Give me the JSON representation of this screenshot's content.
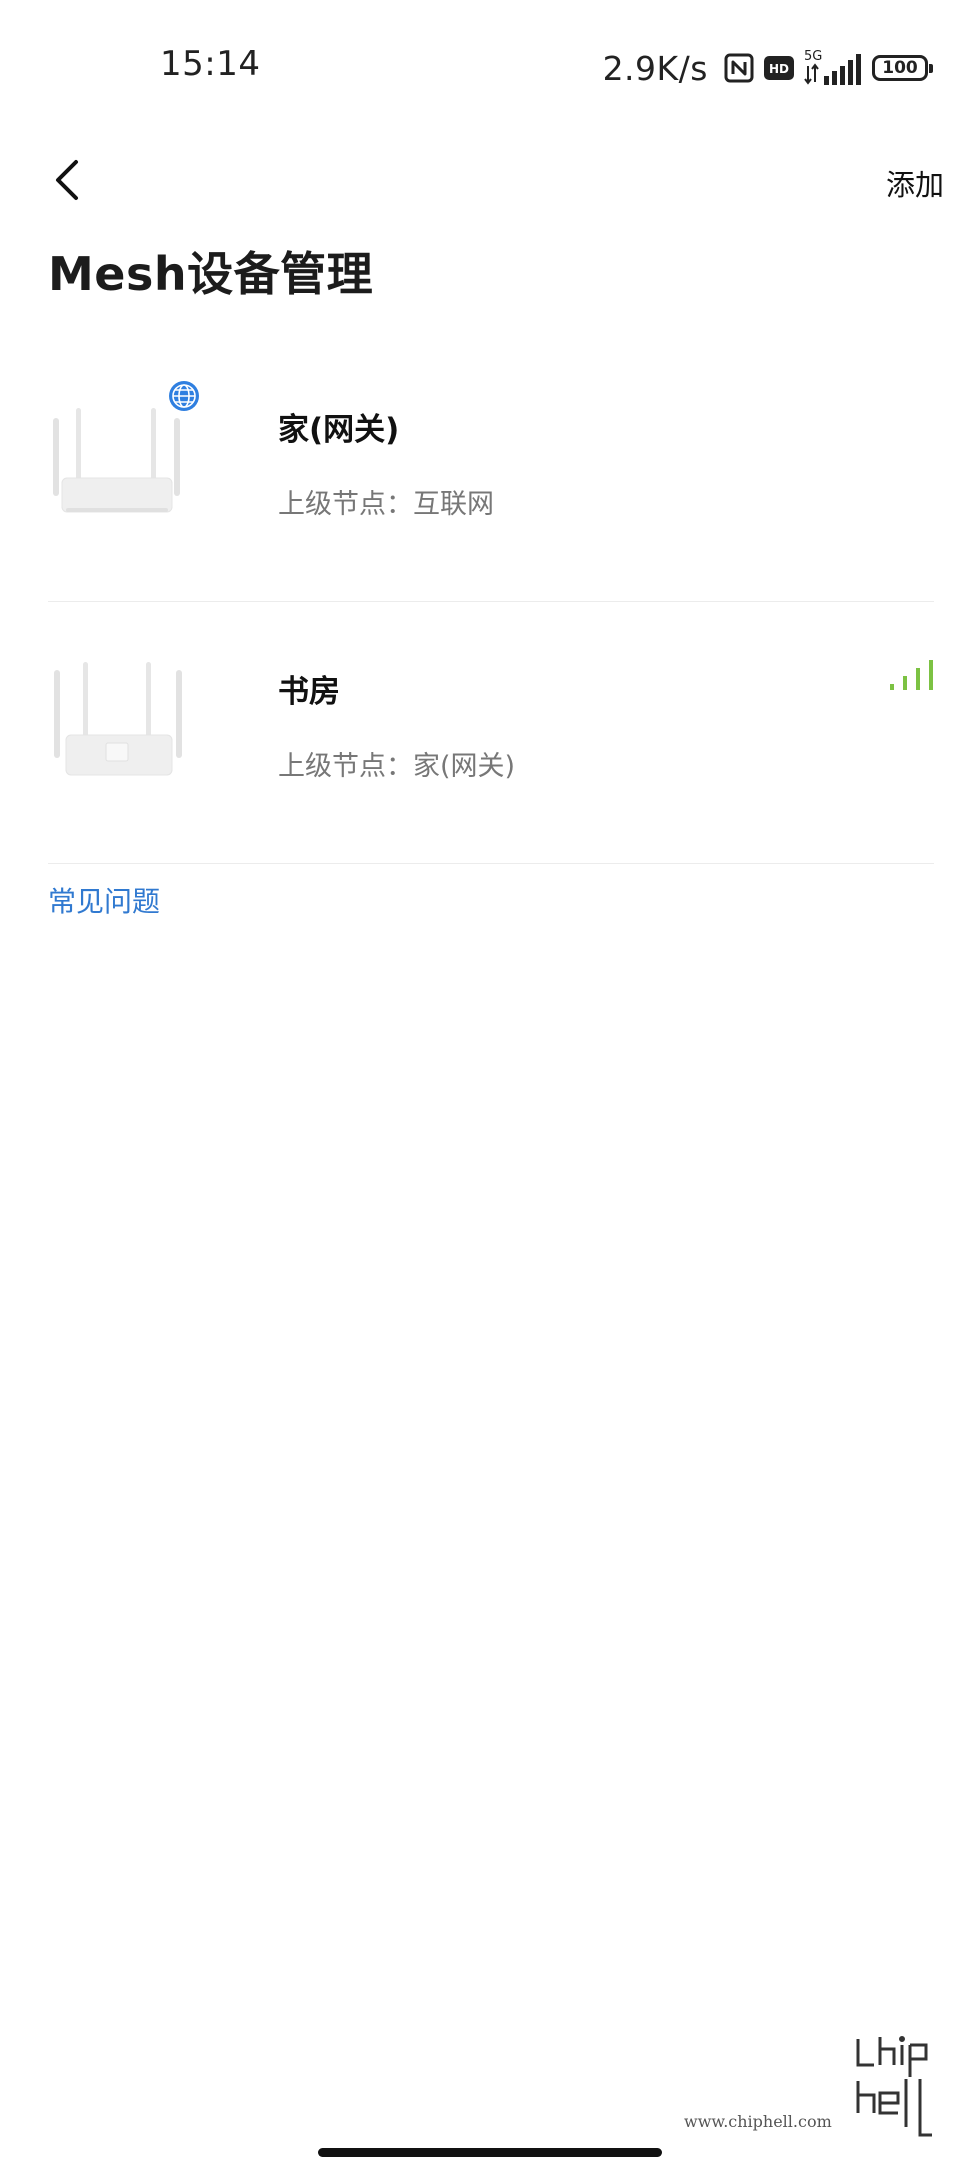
{
  "status_bar": {
    "time": "15:14",
    "net_speed": "2.9K/s",
    "network_type": "5G",
    "hd_label": "HD",
    "battery": "100",
    "icons": [
      "nfc-icon",
      "hd-icon",
      "signal-5g-icon",
      "battery-icon"
    ]
  },
  "header": {
    "add_label": "添加",
    "title": "Mesh设备管理",
    "back_icon": "chevron-left-icon"
  },
  "devices": [
    {
      "name": "家(网关)",
      "parent": "上级节点：互联网",
      "badge_icon": "globe-icon",
      "badge_color": "#2f7fe0",
      "image_icon": "router-image"
    },
    {
      "name": "书房",
      "parent": "上级节点：家(网关)",
      "signal_icon": "signal-strength-icon",
      "signal_color": "#7cc243",
      "signal_level": 1.0,
      "image_icon": "router-image"
    }
  ],
  "faq_label": "常见问题",
  "colors": {
    "link": "#3079d0",
    "secondary_text": "#777777",
    "divider": "#ececec"
  },
  "watermark": {
    "url": "www.chiphell.com",
    "logo": "chiphell-logo"
  }
}
